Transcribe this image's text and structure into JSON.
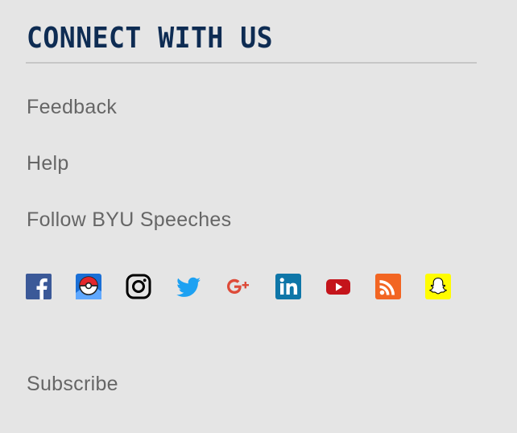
{
  "section": {
    "title": "CONNECT WITH US"
  },
  "links": {
    "feedback": "Feedback",
    "help": "Help",
    "follow": "Follow BYU Speeches",
    "subscribe": "Subscribe"
  },
  "social_icons": [
    {
      "name": "facebook-icon",
      "color": "#3b5998"
    },
    {
      "name": "pokemon-go-icon",
      "color": "#1a6fd6"
    },
    {
      "name": "instagram-icon",
      "color": "#000000"
    },
    {
      "name": "twitter-icon",
      "color": "#1da1f2"
    },
    {
      "name": "google-plus-icon",
      "color": "#dd4b39"
    },
    {
      "name": "linkedin-icon",
      "color": "#0e76a8"
    },
    {
      "name": "youtube-icon",
      "color": "#c4141b"
    },
    {
      "name": "rss-icon",
      "color": "#f26522"
    },
    {
      "name": "snapchat-icon",
      "color": "#fffc00"
    }
  ],
  "colors": {
    "background": "#e5e5e5",
    "heading": "#0e2c53",
    "link": "#666666",
    "rule": "#c6c6c6"
  }
}
